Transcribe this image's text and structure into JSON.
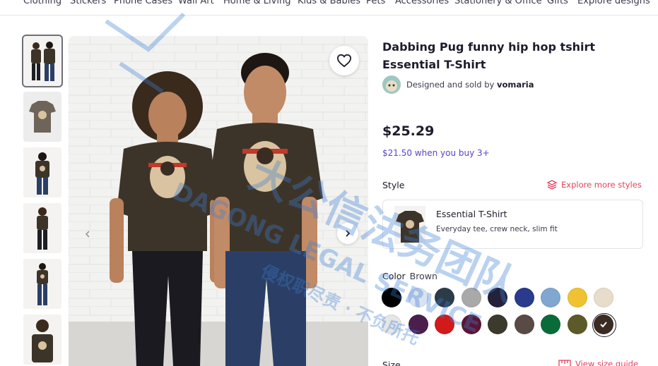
{
  "nav": {
    "items": [
      "Clothing",
      "Stickers",
      "Phone Cases",
      "Wall Art",
      "Home & Living",
      "Kids & Babies",
      "Pets",
      "Accessories",
      "Stationery & Office",
      "Gifts",
      "Explore designs"
    ]
  },
  "product": {
    "title": "Dabbing Pug funny hip hop tshirt Essential T-Shirt",
    "designer_prefix": "Designed and sold by",
    "designer_name": "vomaria",
    "price": "$25.29",
    "bulk_price": "$21.50 when you buy 3+"
  },
  "style": {
    "label": "Style",
    "explore_link": "Explore more styles",
    "card_name": "Essential T-Shirt",
    "card_desc": "Everyday tee, crew neck, slim fit"
  },
  "color": {
    "label": "Color",
    "selected": "Brown",
    "swatches": [
      "#000000",
      "#d9e3f0",
      "#2c3b4a",
      "#a9a9a9",
      "#25213a",
      "#2a3a8c",
      "#7fa7cf",
      "#f0c232",
      "#e8dccb",
      "#e6e6e6",
      "#4b1f4b",
      "#d21a1a",
      "#5a1633",
      "#3c3a2c",
      "#5a4a45",
      "#0a6b3a",
      "#5d5a2a",
      "#3b2c23"
    ],
    "selected_index": 17
  },
  "size": {
    "label": "Size",
    "guide_link": "View size guide"
  },
  "watermark": {
    "line1": "大公信法务团队",
    "line2": "DAGONG LEGAL SERVICE",
    "line3": "侵权职尽责 · 不负所托"
  },
  "colors": {
    "accent_purple": "#5a43c6",
    "accent_red": "#e1445c",
    "shirt_brown": "#3d3429"
  }
}
